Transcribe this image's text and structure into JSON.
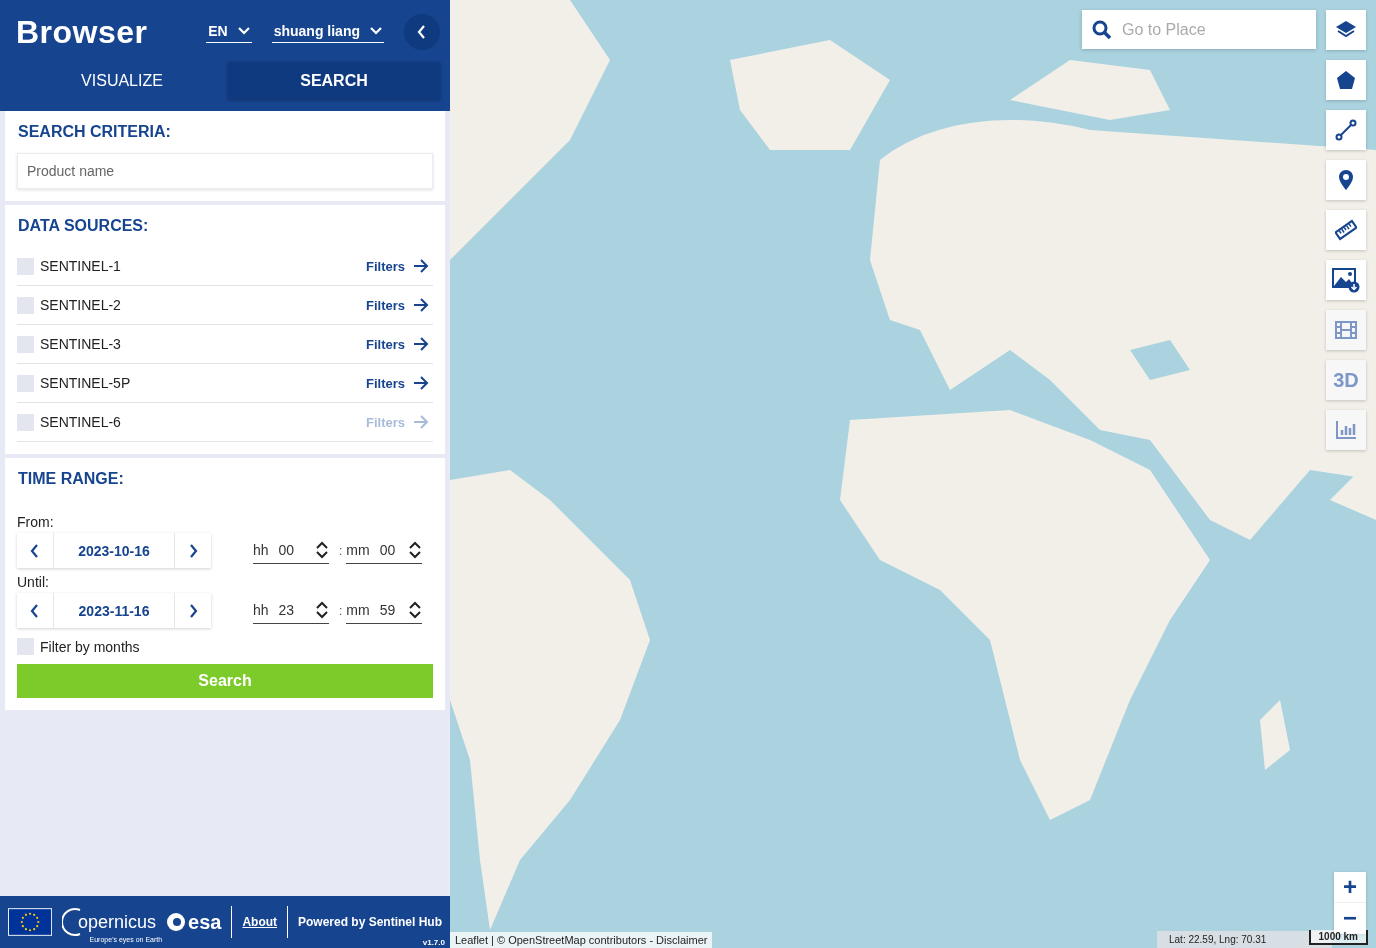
{
  "header": {
    "title": "Browser",
    "language": "EN",
    "user": "shuang liang"
  },
  "tabs": [
    {
      "label": "VISUALIZE",
      "selected": false
    },
    {
      "label": "SEARCH",
      "selected": true
    }
  ],
  "search_criteria": {
    "heading": "SEARCH CRITERIA:",
    "placeholder": "Product name"
  },
  "data_sources": {
    "heading": "DATA SOURCES:",
    "items": [
      {
        "name": "SENTINEL-1",
        "checked": false,
        "filters": "Filters",
        "disabled": false
      },
      {
        "name": "SENTINEL-2",
        "checked": false,
        "filters": "Filters",
        "disabled": false
      },
      {
        "name": "SENTINEL-3",
        "checked": false,
        "filters": "Filters",
        "disabled": false
      },
      {
        "name": "SENTINEL-5P",
        "checked": false,
        "filters": "Filters",
        "disabled": false
      },
      {
        "name": "SENTINEL-6",
        "checked": false,
        "filters": "Filters",
        "disabled": true
      }
    ]
  },
  "time_range": {
    "heading": "TIME RANGE:",
    "ranges": [
      {
        "label": "From:",
        "date": "2023-10-16",
        "hh_label": "hh",
        "hh": "00",
        "separator": ":",
        "mm_label": "mm",
        "mm": "00"
      },
      {
        "label": "Until:",
        "date": "2023-11-16",
        "hh_label": "hh",
        "hh": "23",
        "separator": ":",
        "mm_label": "mm",
        "mm": "59"
      }
    ],
    "filter_by_months": {
      "label": "Filter by months",
      "checked": false
    },
    "search_button": "Search"
  },
  "footer": {
    "copernicus": "opernicus",
    "copernicus_tagline": "Europe's eyes on Earth",
    "esa": "esa",
    "about": "About",
    "powered_by": "Powered by Sentinel Hub",
    "version": "v1.7.0"
  },
  "map": {
    "kind": "picture",
    "search_placeholder": "Go to Place",
    "tools": [
      {
        "kind": "layers",
        "disabled": false
      },
      {
        "kind": "polygon",
        "disabled": false
      },
      {
        "kind": "line",
        "disabled": false
      },
      {
        "kind": "pin",
        "disabled": false
      },
      {
        "kind": "ruler",
        "disabled": false
      },
      {
        "kind": "image-download",
        "disabled": false
      },
      {
        "kind": "film",
        "disabled": true
      },
      {
        "kind": "text",
        "label": "3D",
        "disabled": true
      },
      {
        "kind": "chart",
        "disabled": true
      }
    ],
    "zoom_in": "+",
    "zoom_out": "−",
    "attribution": "Leaflet | © OpenStreetMap contributors - Disclaimer",
    "coordinates": "Lat: 22.59, Lng: 70.31",
    "scale": "1000 km"
  }
}
